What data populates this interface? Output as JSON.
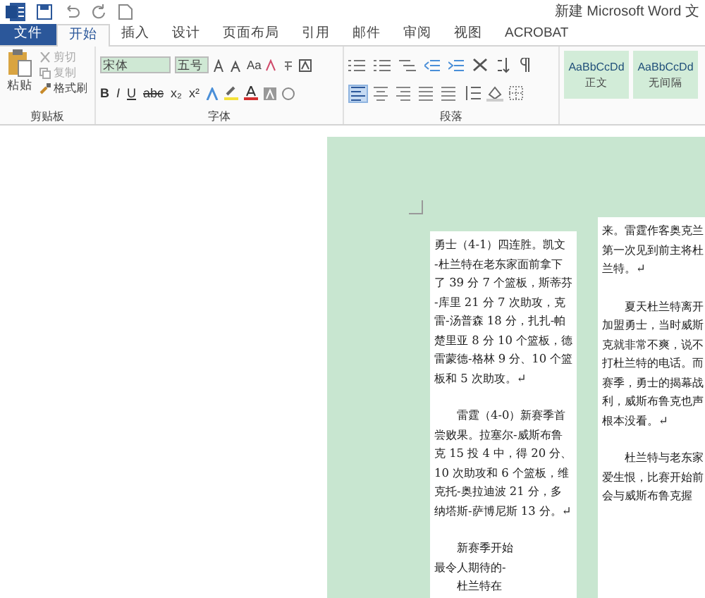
{
  "window": {
    "title": "新建 Microsoft Word 文"
  },
  "tabs": [
    {
      "label": "文件",
      "kind": "file",
      "selected": false
    },
    {
      "label": "开始",
      "kind": "tab",
      "selected": true
    },
    {
      "label": "插入",
      "kind": "tab",
      "selected": false
    },
    {
      "label": "设计",
      "kind": "tab",
      "selected": false
    },
    {
      "label": "页面布局",
      "kind": "tab",
      "selected": false
    },
    {
      "label": "引用",
      "kind": "tab",
      "selected": false
    },
    {
      "label": "邮件",
      "kind": "tab",
      "selected": false
    },
    {
      "label": "审阅",
      "kind": "tab",
      "selected": false
    },
    {
      "label": "视图",
      "kind": "tab",
      "selected": false
    },
    {
      "label": "ACROBAT",
      "kind": "tab",
      "selected": false
    }
  ],
  "clipboard": {
    "paste": "粘贴",
    "cut": "剪切",
    "copy": "复制",
    "format_painter": "格式刷",
    "label": "剪贴板"
  },
  "font": {
    "name": "宋体",
    "size": "五号",
    "row1": [
      "Aa"
    ],
    "row2": [
      "B",
      "I",
      "U",
      "abc",
      "x₂",
      "x²"
    ],
    "label": "字体"
  },
  "paragraph": {
    "label": "段落",
    "alignments": [
      {
        "selected": true
      },
      {
        "selected": false
      },
      {
        "selected": false
      },
      {
        "selected": false
      },
      {
        "selected": false
      }
    ]
  },
  "styles": [
    {
      "sample": "AaBbCcDd",
      "name": "正文",
      "selected": true
    },
    {
      "sample": "AaBbCcDd",
      "name": "无间隔",
      "selected": true
    }
  ],
  "document": {
    "columns": [
      {
        "paragraphs": [
          {
            "lines": [
              "勇士（4-1）四连胜。凯文",
              "-杜兰特在老东家面前拿下",
              "了 39 分 7 个篮板，斯蒂芬",
              "-库里 21 分 7 次助攻，克",
              "雷-汤普森 18 分，扎扎-帕",
              "楚里亚 8 分 10 个篮板，德",
              "雷蒙德-格林 9 分、10 个篮",
              "板和 5 次助攻。↵"
            ]
          },
          {
            "lines": [
              "　　雷霆（4-0）新赛季首",
              "尝败果。拉塞尔-威斯布鲁",
              "克 15 投 4 中，得 20 分、",
              "10 次助攻和 6 个篮板，维",
              "克托-奥拉迪波 21 分，多",
              "纳塔斯-萨博尼斯 13 分。↵"
            ]
          },
          {
            "lines": [
              "　　新赛季开始",
              "最令人期待的-",
              "　　杜兰特在"
            ]
          }
        ]
      },
      {
        "paragraphs": [
          {
            "lines": [
              "来。雷霆作客奥克兰",
              "第一次见到前主将杜",
              "兰特。↵"
            ]
          },
          {
            "lines": [
              "　　夏天杜兰特离开",
              "加盟勇士，当时威斯",
              "克就非常不爽，说不",
              "打杜兰特的电话。而",
              "赛季，勇士的揭幕战",
              "利，威斯布鲁克也声",
              "根本没看。↵"
            ]
          },
          {
            "lines": [
              "　　杜兰特与老东家",
              "爱生恨，比赛开始前",
              "会与威斯布鲁克握"
            ]
          }
        ]
      }
    ]
  }
}
